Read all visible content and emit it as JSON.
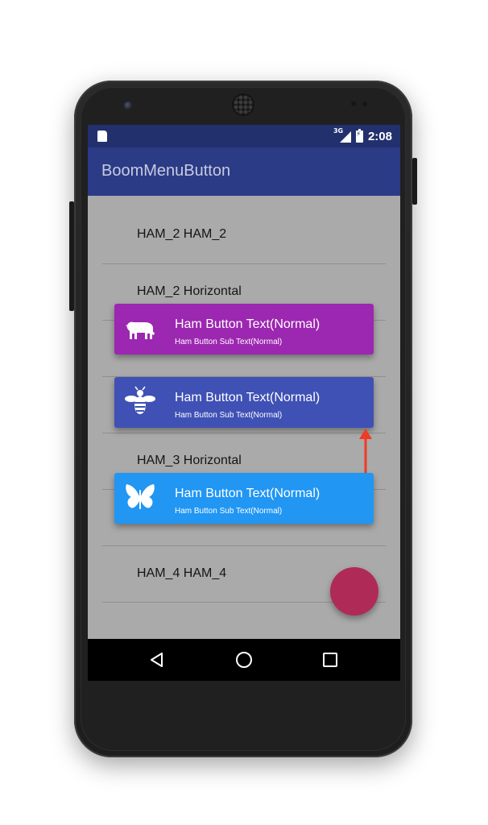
{
  "status_bar": {
    "network_type": "3G",
    "time": "2:08",
    "icons": [
      "sd-card-icon",
      "signal-icon",
      "battery-charging-icon"
    ]
  },
  "app_bar": {
    "title": "BoomMenuButton",
    "color": "#2b3b86"
  },
  "list": {
    "items": [
      {
        "label": "HAM_2 HAM_2"
      },
      {
        "label": "HAM_2 Horizontal"
      },
      {
        "label": "HAM_3 Horizontal"
      },
      {
        "label": "HAM_4 HAM_4"
      }
    ]
  },
  "ham_buttons": [
    {
      "icon": "polar-bear-icon",
      "text": "Ham Button Text(Normal)",
      "sub_text": "Ham Button Sub Text(Normal)",
      "color": "#9c27b0"
    },
    {
      "icon": "bee-icon",
      "text": "Ham Button Text(Normal)",
      "sub_text": "Ham Button Sub Text(Normal)",
      "color": "#3f51b5"
    },
    {
      "icon": "butterfly-icon",
      "text": "Ham Button Text(Normal)",
      "sub_text": "Ham Button Sub Text(Normal)",
      "color": "#2196f3"
    }
  ],
  "boom_button": {
    "icon": "boom-menu-icon",
    "color": "#b02a57"
  },
  "nav_bar": {
    "icons": [
      "back-icon",
      "home-icon",
      "recents-icon"
    ]
  }
}
